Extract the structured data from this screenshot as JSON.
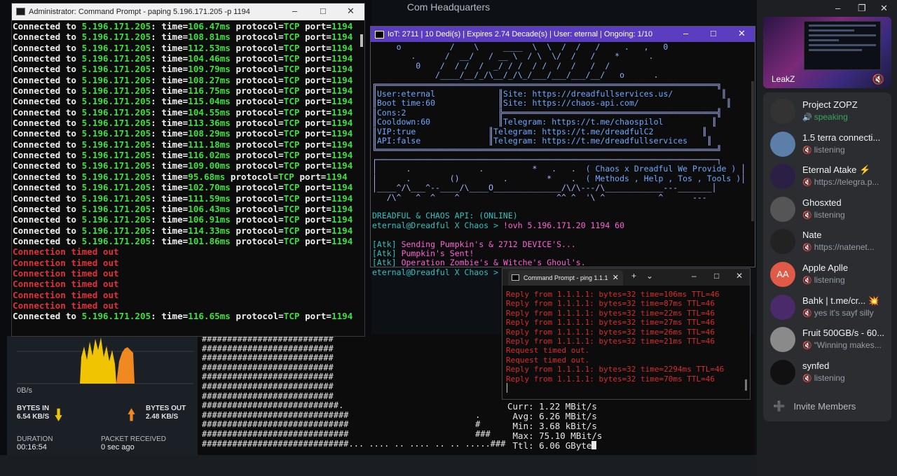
{
  "app": {
    "title": "Com Headquarters"
  },
  "paping": {
    "title": "Administrator: Command Prompt - paping  5.196.171.205 -p 1194",
    "lines": [
      {
        "kind": "ok",
        "ip": "5.196.171.205",
        "time": "106.47ms",
        "proto": "TCP",
        "port": "1194"
      },
      {
        "kind": "ok",
        "ip": "5.196.171.205",
        "time": "108.81ms",
        "proto": "TCP",
        "port": "1194"
      },
      {
        "kind": "ok",
        "ip": "5.196.171.205",
        "time": "112.53ms",
        "proto": "TCP",
        "port": "1194"
      },
      {
        "kind": "ok",
        "ip": "5.196.171.205",
        "time": "104.46ms",
        "proto": "TCP",
        "port": "1194"
      },
      {
        "kind": "ok",
        "ip": "5.196.171.205",
        "time": "109.79ms",
        "proto": "TCP",
        "port": "1194"
      },
      {
        "kind": "ok",
        "ip": "5.196.171.205",
        "time": "108.27ms",
        "proto": "TCP",
        "port": "1194"
      },
      {
        "kind": "ok",
        "ip": "5.196.171.205",
        "time": "116.75ms",
        "proto": "TCP",
        "port": "1194"
      },
      {
        "kind": "ok",
        "ip": "5.196.171.205",
        "time": "115.04ms",
        "proto": "TCP",
        "port": "1194"
      },
      {
        "kind": "ok",
        "ip": "5.196.171.205",
        "time": "104.55ms",
        "proto": "TCP",
        "port": "1194"
      },
      {
        "kind": "ok",
        "ip": "5.196.171.205",
        "time": "113.36ms",
        "proto": "TCP",
        "port": "1194"
      },
      {
        "kind": "ok",
        "ip": "5.196.171.205",
        "time": "108.29ms",
        "proto": "TCP",
        "port": "1194"
      },
      {
        "kind": "ok",
        "ip": "5.196.171.205",
        "time": "111.18ms",
        "proto": "TCP",
        "port": "1194"
      },
      {
        "kind": "ok",
        "ip": "5.196.171.205",
        "time": "116.02ms",
        "proto": "TCP",
        "port": "1194"
      },
      {
        "kind": "ok",
        "ip": "5.196.171.205",
        "time": "109.00ms",
        "proto": "TCP",
        "port": "1194"
      },
      {
        "kind": "ok",
        "ip": "5.196.171.205",
        "time": "95.68ms",
        "proto": "TCP",
        "port": "1194"
      },
      {
        "kind": "ok",
        "ip": "5.196.171.205",
        "time": "102.70ms",
        "proto": "TCP",
        "port": "1194"
      },
      {
        "kind": "ok",
        "ip": "5.196.171.205",
        "time": "111.59ms",
        "proto": "TCP",
        "port": "1194"
      },
      {
        "kind": "ok",
        "ip": "5.196.171.205",
        "time": "106.43ms",
        "proto": "TCP",
        "port": "1194"
      },
      {
        "kind": "ok",
        "ip": "5.196.171.205",
        "time": "106.91ms",
        "proto": "TCP",
        "port": "1194"
      },
      {
        "kind": "ok",
        "ip": "5.196.171.205",
        "time": "114.33ms",
        "proto": "TCP",
        "port": "1194"
      },
      {
        "kind": "ok",
        "ip": "5.196.171.205",
        "time": "101.86ms",
        "proto": "TCP",
        "port": "1194"
      },
      {
        "kind": "timeout",
        "text": "Connection timed out"
      },
      {
        "kind": "timeout",
        "text": "Connection timed out"
      },
      {
        "kind": "timeout",
        "text": "Connection timed out"
      },
      {
        "kind": "timeout",
        "text": "Connection timed out"
      },
      {
        "kind": "timeout",
        "text": "Connection timed out"
      },
      {
        "kind": "timeout",
        "text": "Connection timed out"
      },
      {
        "kind": "ok",
        "ip": "5.196.171.205",
        "time": "116.65ms",
        "proto": "TCP",
        "port": "1194"
      }
    ]
  },
  "dread": {
    "title": "IoT: 2711 | 10 Dedi(s) | Expires 2.74 Decade(s) | User: eternal | Ongoing: 1/10",
    "banner_line1": "     o          /    \\     ____  \\  \\  /  /   /     .   ,   0",
    "banner_line2": "        .      /  __/   / __ \\  / \\  \\/  /   /    *      .    ",
    "banner_line3": "         0    /  / /  /  _/ / /  / /  /  /   /  /               ",
    "banner_line4": "             /____/__/_/\\__/_/\\_/___/___/___/__/   o      .     ",
    "info": {
      "user": "User:eternal",
      "boot": "Boot time:60",
      "cons": "Cons:2",
      "cooldown": "Cooldown:60",
      "vip": "VIP:true",
      "api": "API:false",
      "site1": "Site: https://dreadfullservices.us/",
      "site2": "Site: https://chaos-api.com/",
      "tg1": "Telegram: https://t.me/chaospilol",
      "tg2": "Telegram: https://t.me/dreadfulC2",
      "tg3": "Telegram: https://t.me/dreadfullservices"
    },
    "menu1": "( Chaos x Dreadful We Provide )",
    "menu2": "( Methods , Help , Tos , Tools )",
    "api_status": "DREADFUL & CHAOS API: (ONLINE)",
    "prompt": "eternal@Dreadful X Chaos > ",
    "command": "!ovh 5.196.171.20 1194 60",
    "atk1": "Sending Pumpkin's & 2712 DEVICE'S...",
    "atk2": "Pumpkin's Sent!",
    "atk3": "Operation Zombie's & Witche's Ghoul's.",
    "atk_tag": "[Atk]",
    "prompt_final": "eternal@Dreadful X Chaos > _"
  },
  "ping": {
    "tab_title": "Command Prompt - ping  1.1.1",
    "lines": [
      "Reply from 1.1.1.1: bytes=32 time=106ms TTL=46",
      "Reply from 1.1.1.1: bytes=32 time=87ms TTL=46",
      "Reply from 1.1.1.1: bytes=32 time=22ms TTL=46",
      "Reply from 1.1.1.1: bytes=32 time=27ms TTL=46",
      "Reply from 1.1.1.1: bytes=32 time=26ms TTL=46",
      "Reply from 1.1.1.1: bytes=32 time=21ms TTL=46",
      "Request timed out.",
      "Request timed out.",
      "Reply from 1.1.1.1: bytes=32 time=2294ms TTL=46",
      "Reply from 1.1.1.1: bytes=32 time=70ms TTL=46"
    ]
  },
  "stats": {
    "curr": "Curr: 1.22 MBit/s",
    "avg": " Avg: 6.26 MBit/s",
    "min": " Min: 3.68 kBit/s",
    "max": " Max: 75.10 MBit/s",
    "ttl": " Ttl: 6.06 GByte"
  },
  "net": {
    "zero": "0B/s",
    "bytes_in_label": "BYTES IN",
    "bytes_in": "6.54 KB/S",
    "bytes_out_label": "BYTES OUT",
    "bytes_out": "2.48 KB/S",
    "duration_label": "DURATION",
    "duration": "00:16:54",
    "packet_label": "PACKET RECEIVED",
    "packet": "0 sec ago",
    "in_color": "#f0c400",
    "out_color": "#f08a20"
  },
  "stream": {
    "name": "LeakZ",
    "mute_icon": "mic-muted-icon"
  },
  "voice": {
    "members": [
      {
        "name": "Project ZOPZ",
        "status": "speaking",
        "speaking": true
      },
      {
        "name": "1.5 terra connecti...",
        "status": "listening",
        "speaking": false
      },
      {
        "name": "Eternal Atake ⚡",
        "status": "https://telegra.p...",
        "speaking": false
      },
      {
        "name": "Ghosxted",
        "status": "listening",
        "speaking": false
      },
      {
        "name": "Nate",
        "status": "https://natenet...",
        "speaking": false
      },
      {
        "name": "Apple Aplle",
        "status": "listening",
        "speaking": false,
        "initials": "AA"
      },
      {
        "name": "Bahk | t.me/cr... 💥",
        "status": "yes it's sayf silly",
        "speaking": false
      },
      {
        "name": "Fruit 500GB/s - 60...",
        "status": "“Winning makes...",
        "speaking": false
      },
      {
        "name": "synfed",
        "status": "listening",
        "speaking": false
      }
    ],
    "invite": "Invite Members"
  }
}
